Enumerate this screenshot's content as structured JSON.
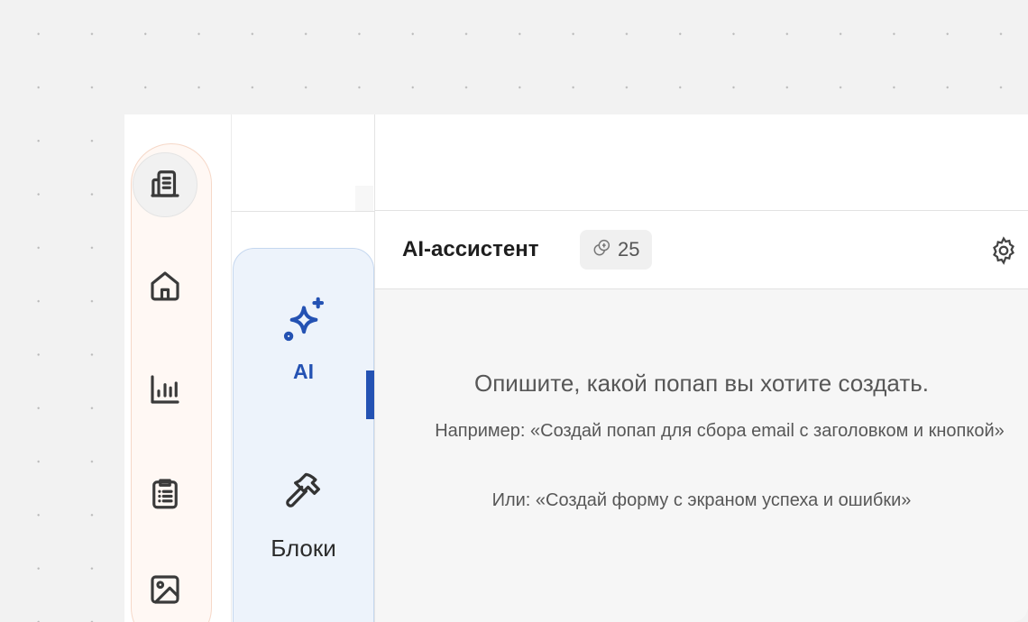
{
  "rail": {
    "items": [
      {
        "icon": "building-icon"
      },
      {
        "icon": "home-icon"
      },
      {
        "icon": "chart-icon"
      },
      {
        "icon": "clipboard-icon"
      },
      {
        "icon": "image-icon"
      }
    ]
  },
  "tools": {
    "ai_label": "AI",
    "blocks_label": "Блоки"
  },
  "assistant": {
    "title": "AI-ассистент",
    "credits": "25",
    "prompt_main": "Опишите, какой попап вы хотите создать.",
    "prompt_example": "Например: «Создай попап для сбора email с заголовком и кнопкой»",
    "prompt_or": "Или: «Создай форму с экраном успеха и ошибки»"
  },
  "colors": {
    "accent": "#2452b3",
    "rail_border": "#f6d8c8",
    "tool_bg": "#edf3fb"
  }
}
